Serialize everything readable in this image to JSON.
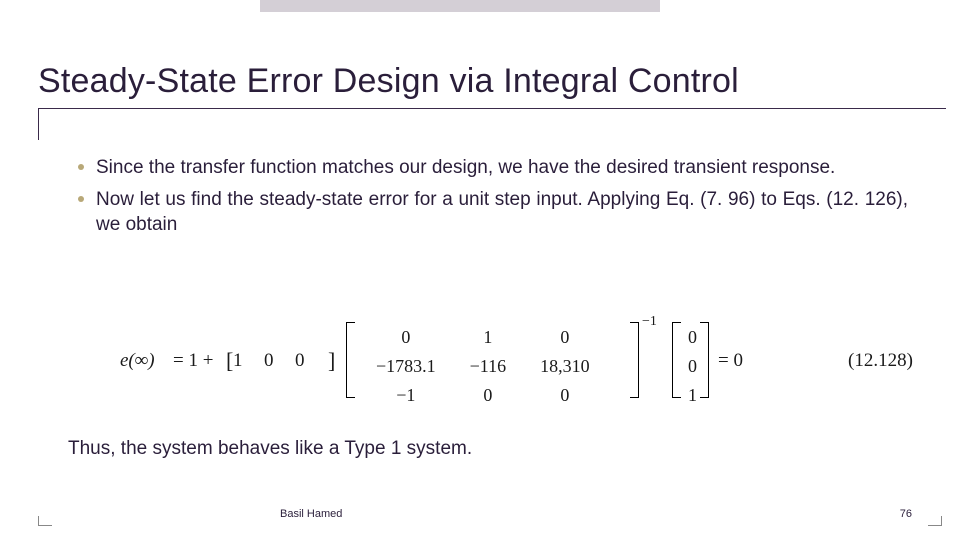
{
  "title": "Steady-State Error Design via Integral Control",
  "bullets": [
    "Since the transfer function matches our design, we have the desired transient response.",
    "Now let us find the steady-state error for a unit step input. Applying Eq. (7. 96) to Eqs. (12. 126), we obtain"
  ],
  "equation": {
    "lhs": "e(∞)",
    "prefix": "= 1 +",
    "rowvec": [
      "1",
      "0",
      "0"
    ],
    "matrix": [
      [
        "0",
        "1",
        "0"
      ],
      [
        "−1783.1",
        "−116",
        "18,310"
      ],
      [
        "−1",
        "0",
        "0"
      ]
    ],
    "exponent": "−1",
    "colvec": [
      "0",
      "0",
      "1"
    ],
    "result": "= 0",
    "label": "(12.128)"
  },
  "conclusion": "Thus, the system behaves like a Type 1 system.",
  "footer": {
    "author": "Basil Hamed",
    "page": "76"
  }
}
